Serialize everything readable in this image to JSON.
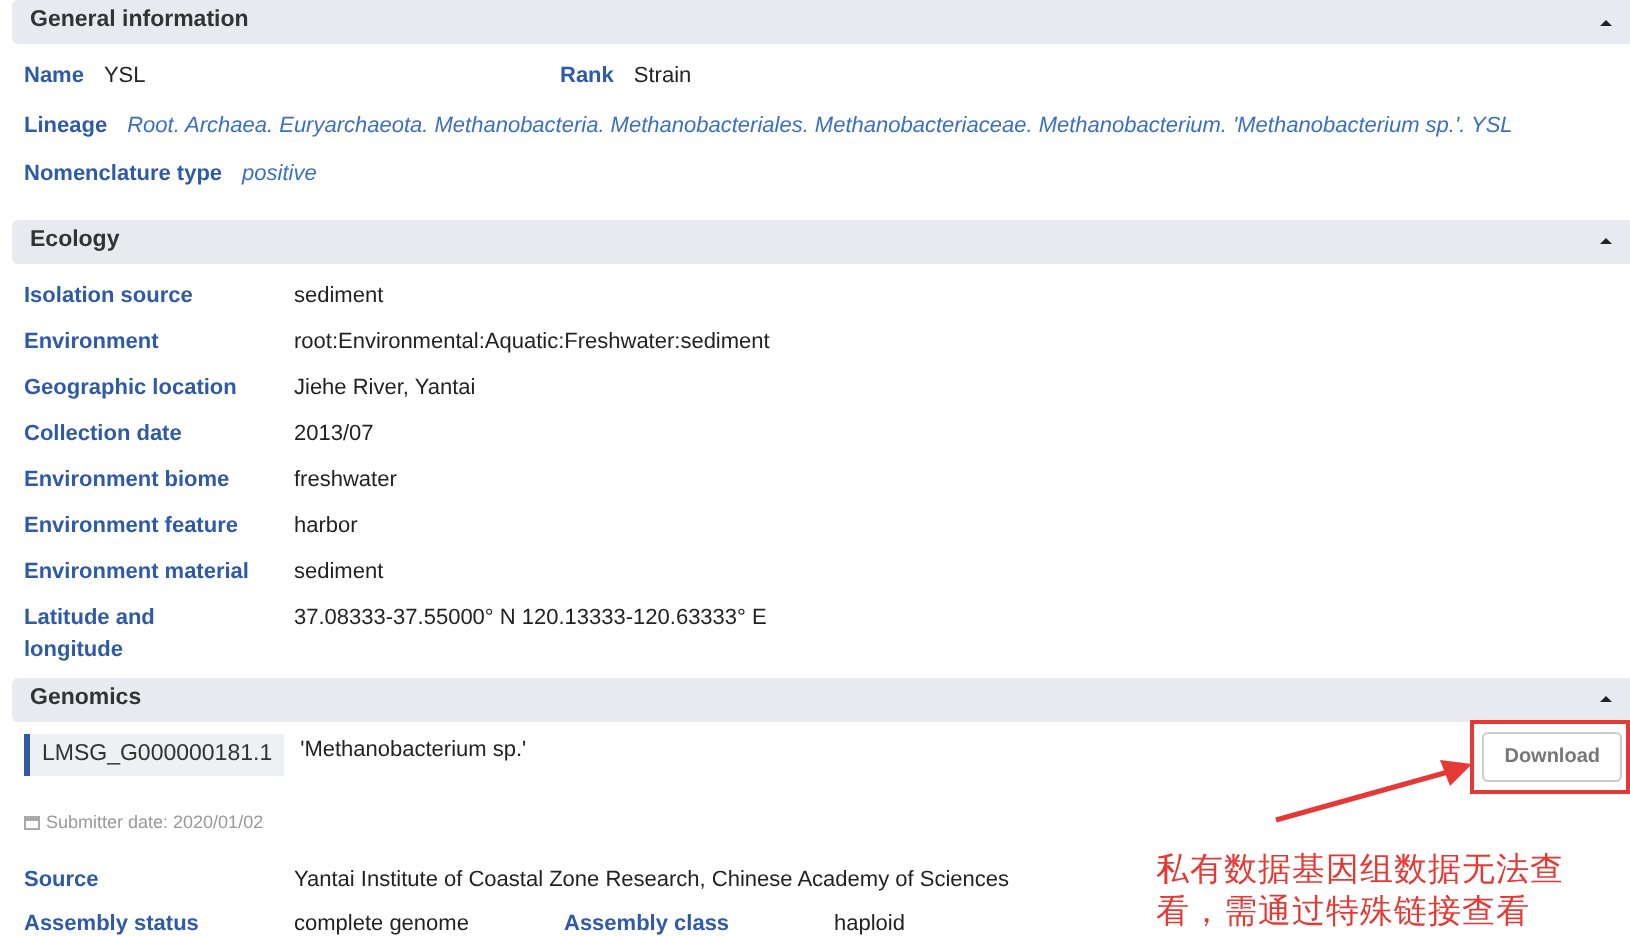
{
  "general": {
    "title": "General information",
    "expanded": true,
    "rows": [
      [
        {
          "label": "Name",
          "value": "YSL"
        },
        {
          "label": "Rank",
          "value": "Strain"
        }
      ],
      [
        {
          "label": "Lineage",
          "value": "Root. Archaea. Euryarchaeota. Methanobacteria. Methanobacteriales. Methanobacteriaceae. Methanobacterium. 'Methanobacterium sp.'. YSL",
          "kind": "link"
        }
      ],
      [
        {
          "label": "Nomenclature type",
          "value": "positive",
          "kind": "link"
        }
      ]
    ]
  },
  "ecology": {
    "title": "Ecology",
    "expanded": true,
    "rows": [
      {
        "label": "Isolation source",
        "value": "sediment"
      },
      {
        "label": "Environment",
        "value": "root:Environmental:Aquatic:Freshwater:sediment"
      },
      {
        "label": "Geographic location",
        "value": "Jiehe River, Yantai"
      },
      {
        "label": "Collection date",
        "value": "2013/07"
      },
      {
        "label": "Environment biome",
        "value": "freshwater"
      },
      {
        "label": "Environment feature",
        "value": "harbor"
      },
      {
        "label": "Environment material",
        "value": "sediment"
      },
      {
        "label": "Latitude and longitude",
        "value": "37.08333-37.55000° N 120.13333-120.63333° E"
      }
    ]
  },
  "genomics": {
    "title": "Genomics",
    "expanded": true,
    "genomes": [
      {
        "accession": "LMSG_G000000181.1",
        "organism": "'Methanobacterium sp.'",
        "button": "Download",
        "submitter_date": "Submitter date: 2020/01/02",
        "rows": [
          [
            {
              "label": "Source",
              "value": "Yantai Institute of Coastal Zone Research, Chinese Academy of Sciences"
            }
          ],
          [
            {
              "label": "Assembly status",
              "value": "complete genome"
            },
            {
              "label": "Assembly class",
              "value": "haploid"
            }
          ]
        ]
      }
    ]
  },
  "annotation": {
    "text": "私有数据基因组数据无法查看，需通过特殊链接查看"
  }
}
